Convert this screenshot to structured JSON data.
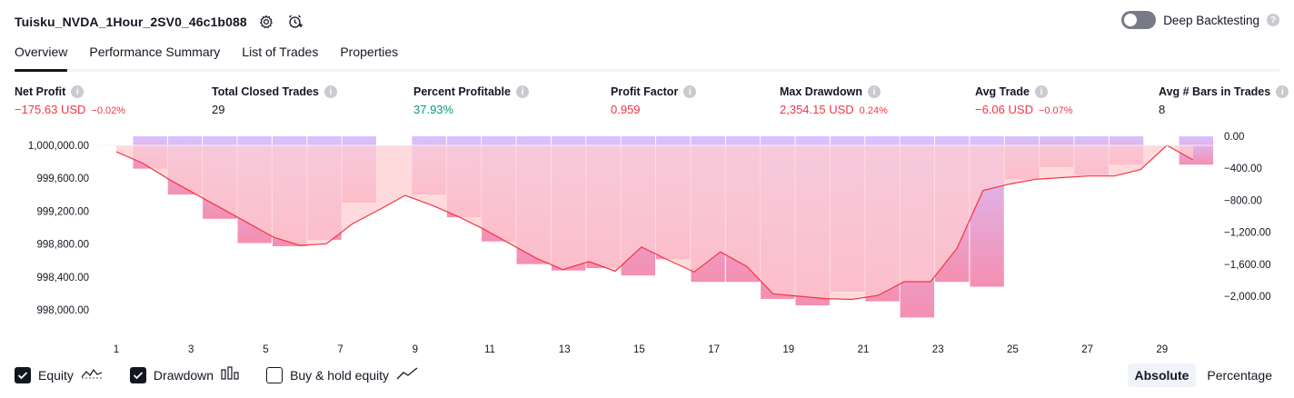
{
  "header": {
    "strategy_name": "Tuisku_NVDA_1Hour_2SV0_46c1b088",
    "deep_backtesting_label": "Deep Backtesting",
    "deep_backtesting_on": false
  },
  "tabs": [
    {
      "label": "Overview",
      "active": true
    },
    {
      "label": "Performance Summary",
      "active": false
    },
    {
      "label": "List of Trades",
      "active": false
    },
    {
      "label": "Properties",
      "active": false
    }
  ],
  "metrics": [
    {
      "label": "Net Profit",
      "value": "−175.63 USD",
      "pct": "−0.02%",
      "tone": "neg"
    },
    {
      "label": "Total Closed Trades",
      "value": "29",
      "pct": "",
      "tone": "neutral"
    },
    {
      "label": "Percent Profitable",
      "value": "37.93%",
      "pct": "",
      "tone": "pos"
    },
    {
      "label": "Profit Factor",
      "value": "0.959",
      "pct": "",
      "tone": "neg"
    },
    {
      "label": "Max Drawdown",
      "value": "2,354.15 USD",
      "pct": "0.24%",
      "tone": "neg"
    },
    {
      "label": "Avg Trade",
      "value": "−6.06 USD",
      "pct": "−0.07%",
      "tone": "neg"
    },
    {
      "label": "Avg # Bars in Trades",
      "value": "8",
      "pct": "",
      "tone": "neutral"
    }
  ],
  "chart_data": {
    "type": "line",
    "y_left_ticks": [
      "1,000,000.00",
      "999,600.00",
      "999,200.00",
      "998,800.00",
      "998,400.00",
      "998,000.00"
    ],
    "y_right_ticks": [
      "0.00",
      "−400.00",
      "−800.00",
      "−1,200.00",
      "−1,600.00",
      "−2,000.00"
    ],
    "x_ticks": [
      "1",
      "3",
      "5",
      "7",
      "9",
      "11",
      "13",
      "15",
      "17",
      "19",
      "21",
      "23",
      "25",
      "27",
      "29"
    ],
    "x": [
      1,
      2,
      3,
      4,
      5,
      6,
      7,
      8,
      9,
      10,
      11,
      12,
      13,
      14,
      15,
      16,
      17,
      18,
      19,
      20,
      21,
      22,
      23,
      24,
      25,
      26,
      27,
      28,
      29,
      30
    ],
    "equity": [
      999880,
      999590,
      999320,
      999050,
      998780,
      998540,
      998720,
      999140,
      999560,
      999340,
      999120,
      998900,
      998680,
      998480,
      998520,
      998420,
      998740,
      998520,
      998290,
      998590,
      998000,
      997960,
      997970,
      998000,
      998270,
      998260,
      998870,
      999040,
      999100,
      999100
    ],
    "drawdown": [
      0,
      -400,
      -720,
      -1020,
      -1320,
      -1360,
      -1280,
      -820,
      0,
      -720,
      -1000,
      -1300,
      -1580,
      -1660,
      -1630,
      -1720,
      -1520,
      -1800,
      -1800,
      -2010,
      -2090,
      -1920,
      -2040,
      -2240,
      -1800,
      -1860,
      -530,
      -380,
      -480,
      -350,
      0,
      -350
    ],
    "equity_series": [
      999920,
      999780,
      999580,
      999400,
      999220,
      999040,
      998860,
      998760,
      998780,
      999030,
      999200,
      999380,
      999260,
      999120,
      998960,
      998780,
      998600,
      998460,
      998560,
      998440,
      998740,
      998580,
      998430,
      998680,
      998500,
      998160,
      998130,
      998100,
      998090,
      998140,
      998310,
      998310,
      998720,
      999440,
      999520,
      999580,
      999600,
      999620,
      999620,
      999700,
      1000000,
      999820
    ],
    "legend": {
      "equity_label": "Equity",
      "drawdown_label": "Drawdown",
      "buyhold_label": "Buy & hold equity",
      "equity_on": true,
      "drawdown_on": true,
      "buyhold_on": false
    },
    "colors": {
      "equity_line": "#f23645",
      "equity_fill": "#ffcdd2",
      "drawdown_fill_top": "#d8c2ff",
      "drawdown_fill_bottom": "#f48fb1",
      "above_fill": "#a5d6a7"
    }
  },
  "modes": [
    {
      "label": "Absolute",
      "active": true
    },
    {
      "label": "Percentage",
      "active": false
    }
  ]
}
